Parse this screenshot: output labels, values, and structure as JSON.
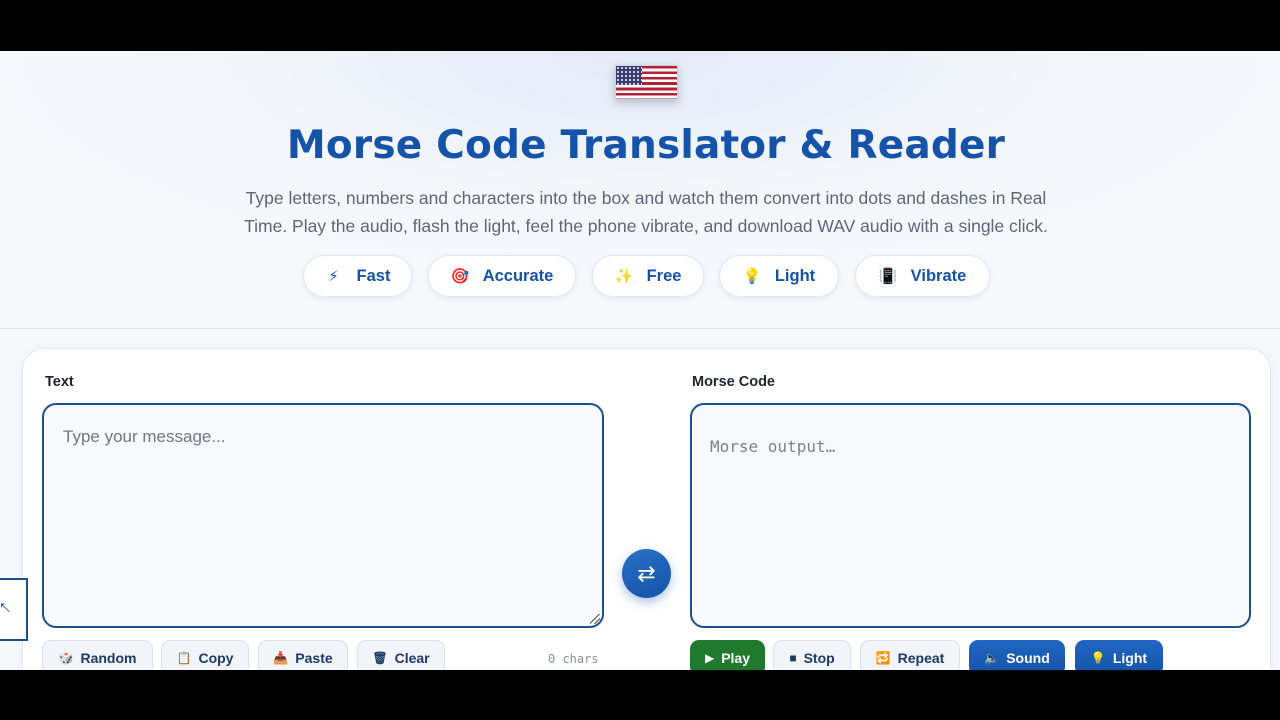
{
  "hero": {
    "title": "Morse Code Translator & Reader",
    "subtitle": "Type letters, numbers and characters into the box and watch them convert into dots and dashes in Real Time. Play the audio, flash the light, feel the phone vibrate, and download WAV audio with a single click.",
    "flag_icon": "us-flag-icon",
    "chips": [
      {
        "label": "Fast",
        "icon": "lightning-icon",
        "glyph": "⚡"
      },
      {
        "label": "Accurate",
        "icon": "target-icon",
        "glyph": "🎯"
      },
      {
        "label": "Free",
        "icon": "sparkles-icon",
        "glyph": "✨"
      },
      {
        "label": "Light",
        "icon": "bulb-icon",
        "glyph": "💡"
      },
      {
        "label": "Vibrate",
        "icon": "vibrate-icon",
        "glyph": "📳"
      }
    ]
  },
  "translator": {
    "text_label": "Text",
    "text_placeholder": "Type your message...",
    "morse_label": "Morse Code",
    "morse_placeholder": "Morse output…",
    "char_count": "0 chars",
    "swap_glyph": "⇄",
    "text_actions": [
      {
        "label": "Random",
        "icon": "dice-icon",
        "glyph": "🎲"
      },
      {
        "label": "Copy",
        "icon": "clipboard-icon",
        "glyph": "📋"
      },
      {
        "label": "Paste",
        "icon": "paste-icon",
        "glyph": "📥"
      },
      {
        "label": "Clear",
        "icon": "trash-icon",
        "glyph": "🗑"
      }
    ],
    "morse_actions": [
      {
        "label": "Play",
        "icon": "play-icon",
        "glyph": "▶"
      },
      {
        "label": "Stop",
        "icon": "stop-icon",
        "glyph": "■"
      },
      {
        "label": "Repeat",
        "icon": "repeat-icon",
        "glyph": "🔁"
      },
      {
        "label": "Sound",
        "icon": "speaker-icon",
        "glyph": "🔈"
      },
      {
        "label": "Light",
        "icon": "bulb-icon",
        "glyph": "💡"
      }
    ]
  },
  "colors": {
    "accent": "#1553a8",
    "play": "#1f7a2e",
    "border": "#1b4f8f"
  }
}
